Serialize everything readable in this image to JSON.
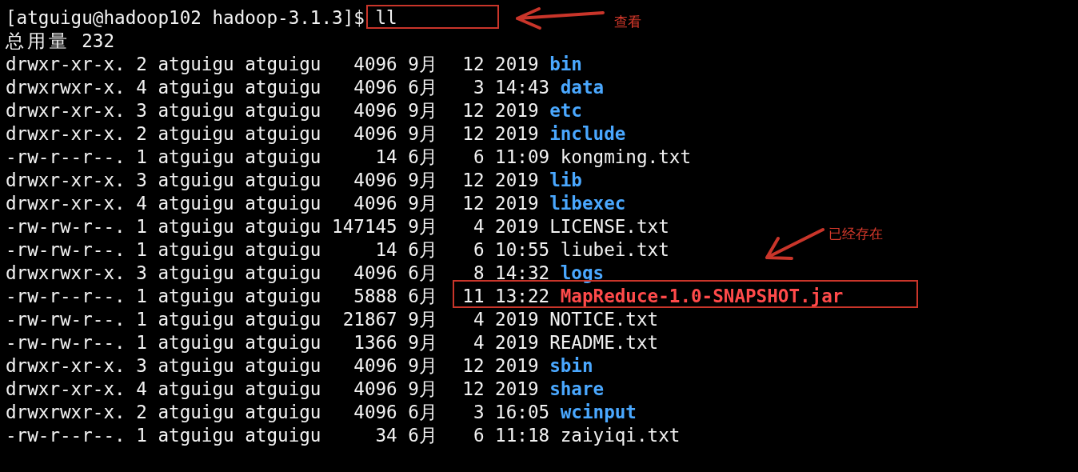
{
  "terminal": {
    "prompt": "[atguigu@hadoop102 hadoop-3.1.3]$ ",
    "command": "ll",
    "total": "总用量 232",
    "rows": [
      {
        "info": "drwxr-xr-x. 2 atguigu atguigu   4096 9月  12 2019",
        "name": "bin",
        "kind": "dir"
      },
      {
        "info": "drwxrwxr-x. 4 atguigu atguigu   4096 6月   3 14:43",
        "name": "data",
        "kind": "dir"
      },
      {
        "info": "drwxr-xr-x. 3 atguigu atguigu   4096 9月  12 2019",
        "name": "etc",
        "kind": "dir"
      },
      {
        "info": "drwxr-xr-x. 2 atguigu atguigu   4096 9月  12 2019",
        "name": "include",
        "kind": "dir"
      },
      {
        "info": "-rw-r--r--. 1 atguigu atguigu     14 6月   6 11:09",
        "name": "kongming.txt",
        "kind": "file"
      },
      {
        "info": "drwxr-xr-x. 3 atguigu atguigu   4096 9月  12 2019",
        "name": "lib",
        "kind": "dir"
      },
      {
        "info": "drwxr-xr-x. 4 atguigu atguigu   4096 9月  12 2019",
        "name": "libexec",
        "kind": "dir"
      },
      {
        "info": "-rw-rw-r--. 1 atguigu atguigu 147145 9月   4 2019",
        "name": "LICENSE.txt",
        "kind": "file"
      },
      {
        "info": "-rw-rw-r--. 1 atguigu atguigu     14 6月   6 10:55",
        "name": "liubei.txt",
        "kind": "file"
      },
      {
        "info": "drwxrwxr-x. 3 atguigu atguigu   4096 6月   8 14:32",
        "name": "logs",
        "kind": "dir"
      },
      {
        "info": "-rw-r--r--. 1 atguigu atguigu   5888 6月  11 13:22",
        "name": "MapReduce-1.0-SNAPSHOT.jar",
        "kind": "jar"
      },
      {
        "info": "-rw-rw-r--. 1 atguigu atguigu  21867 9月   4 2019",
        "name": "NOTICE.txt",
        "kind": "file"
      },
      {
        "info": "-rw-rw-r--. 1 atguigu atguigu   1366 9月   4 2019",
        "name": "README.txt",
        "kind": "file"
      },
      {
        "info": "drwxr-xr-x. 3 atguigu atguigu   4096 9月  12 2019",
        "name": "sbin",
        "kind": "dir"
      },
      {
        "info": "drwxr-xr-x. 4 atguigu atguigu   4096 9月  12 2019",
        "name": "share",
        "kind": "dir"
      },
      {
        "info": "drwxrwxr-x. 2 atguigu atguigu   4096 6月   3 16:05",
        "name": "wcinput",
        "kind": "dir"
      },
      {
        "info": "-rw-r--r--. 1 atguigu atguigu     34 6月   6 11:18",
        "name": "zaiyiqi.txt",
        "kind": "file"
      }
    ]
  },
  "annotations": [
    {
      "label": "查看"
    },
    {
      "label": "已经存在"
    }
  ]
}
